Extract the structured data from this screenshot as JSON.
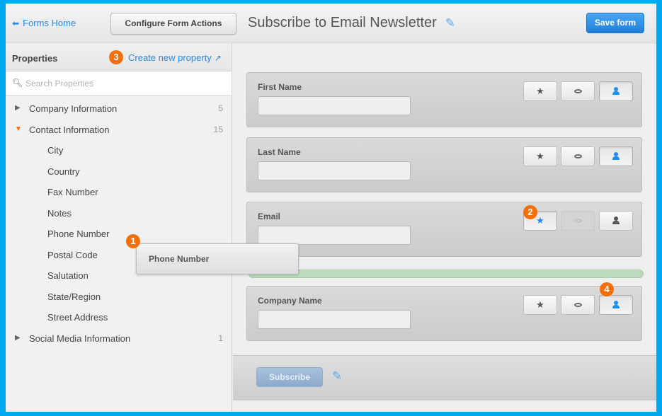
{
  "topbar": {
    "forms_home_label": "Forms Home",
    "configure_label": "Configure Form Actions",
    "form_title": "Subscribe to Email Newsletter",
    "save_label": "Save form"
  },
  "sidebar": {
    "title": "Properties",
    "create_link_label": "Create new property",
    "search_placeholder": "Search Properties",
    "groups": [
      {
        "label": "Company Information",
        "count": "5",
        "expanded": false
      },
      {
        "label": "Contact Information",
        "count": "15",
        "expanded": true,
        "children": [
          "City",
          "Country",
          "Fax Number",
          "Notes",
          "Phone Number",
          "Postal Code",
          "Salutation",
          "State/Region",
          "Street Address"
        ]
      },
      {
        "label": "Social Media Information",
        "count": "1",
        "expanded": false
      }
    ]
  },
  "drag_item": {
    "label": "Phone Number"
  },
  "fields": [
    {
      "label": "First Name",
      "required": false,
      "hidden": false,
      "smart": true
    },
    {
      "label": "Last Name",
      "required": false,
      "hidden": false,
      "smart": true
    },
    {
      "label": "Email",
      "required": true,
      "hidden_disabled": true,
      "smart": false
    },
    {
      "label": "Company Name",
      "required": false,
      "hidden": false,
      "smart": true
    }
  ],
  "footer": {
    "submit_label": "Subscribe"
  },
  "badges": {
    "b1": "1",
    "b2": "2",
    "b3": "3",
    "b4": "4"
  },
  "colors": {
    "accent": "#2a8ae0",
    "badge": "#f2700c",
    "drop_zone": "#bcdabc",
    "frame": "#00a8f3"
  }
}
